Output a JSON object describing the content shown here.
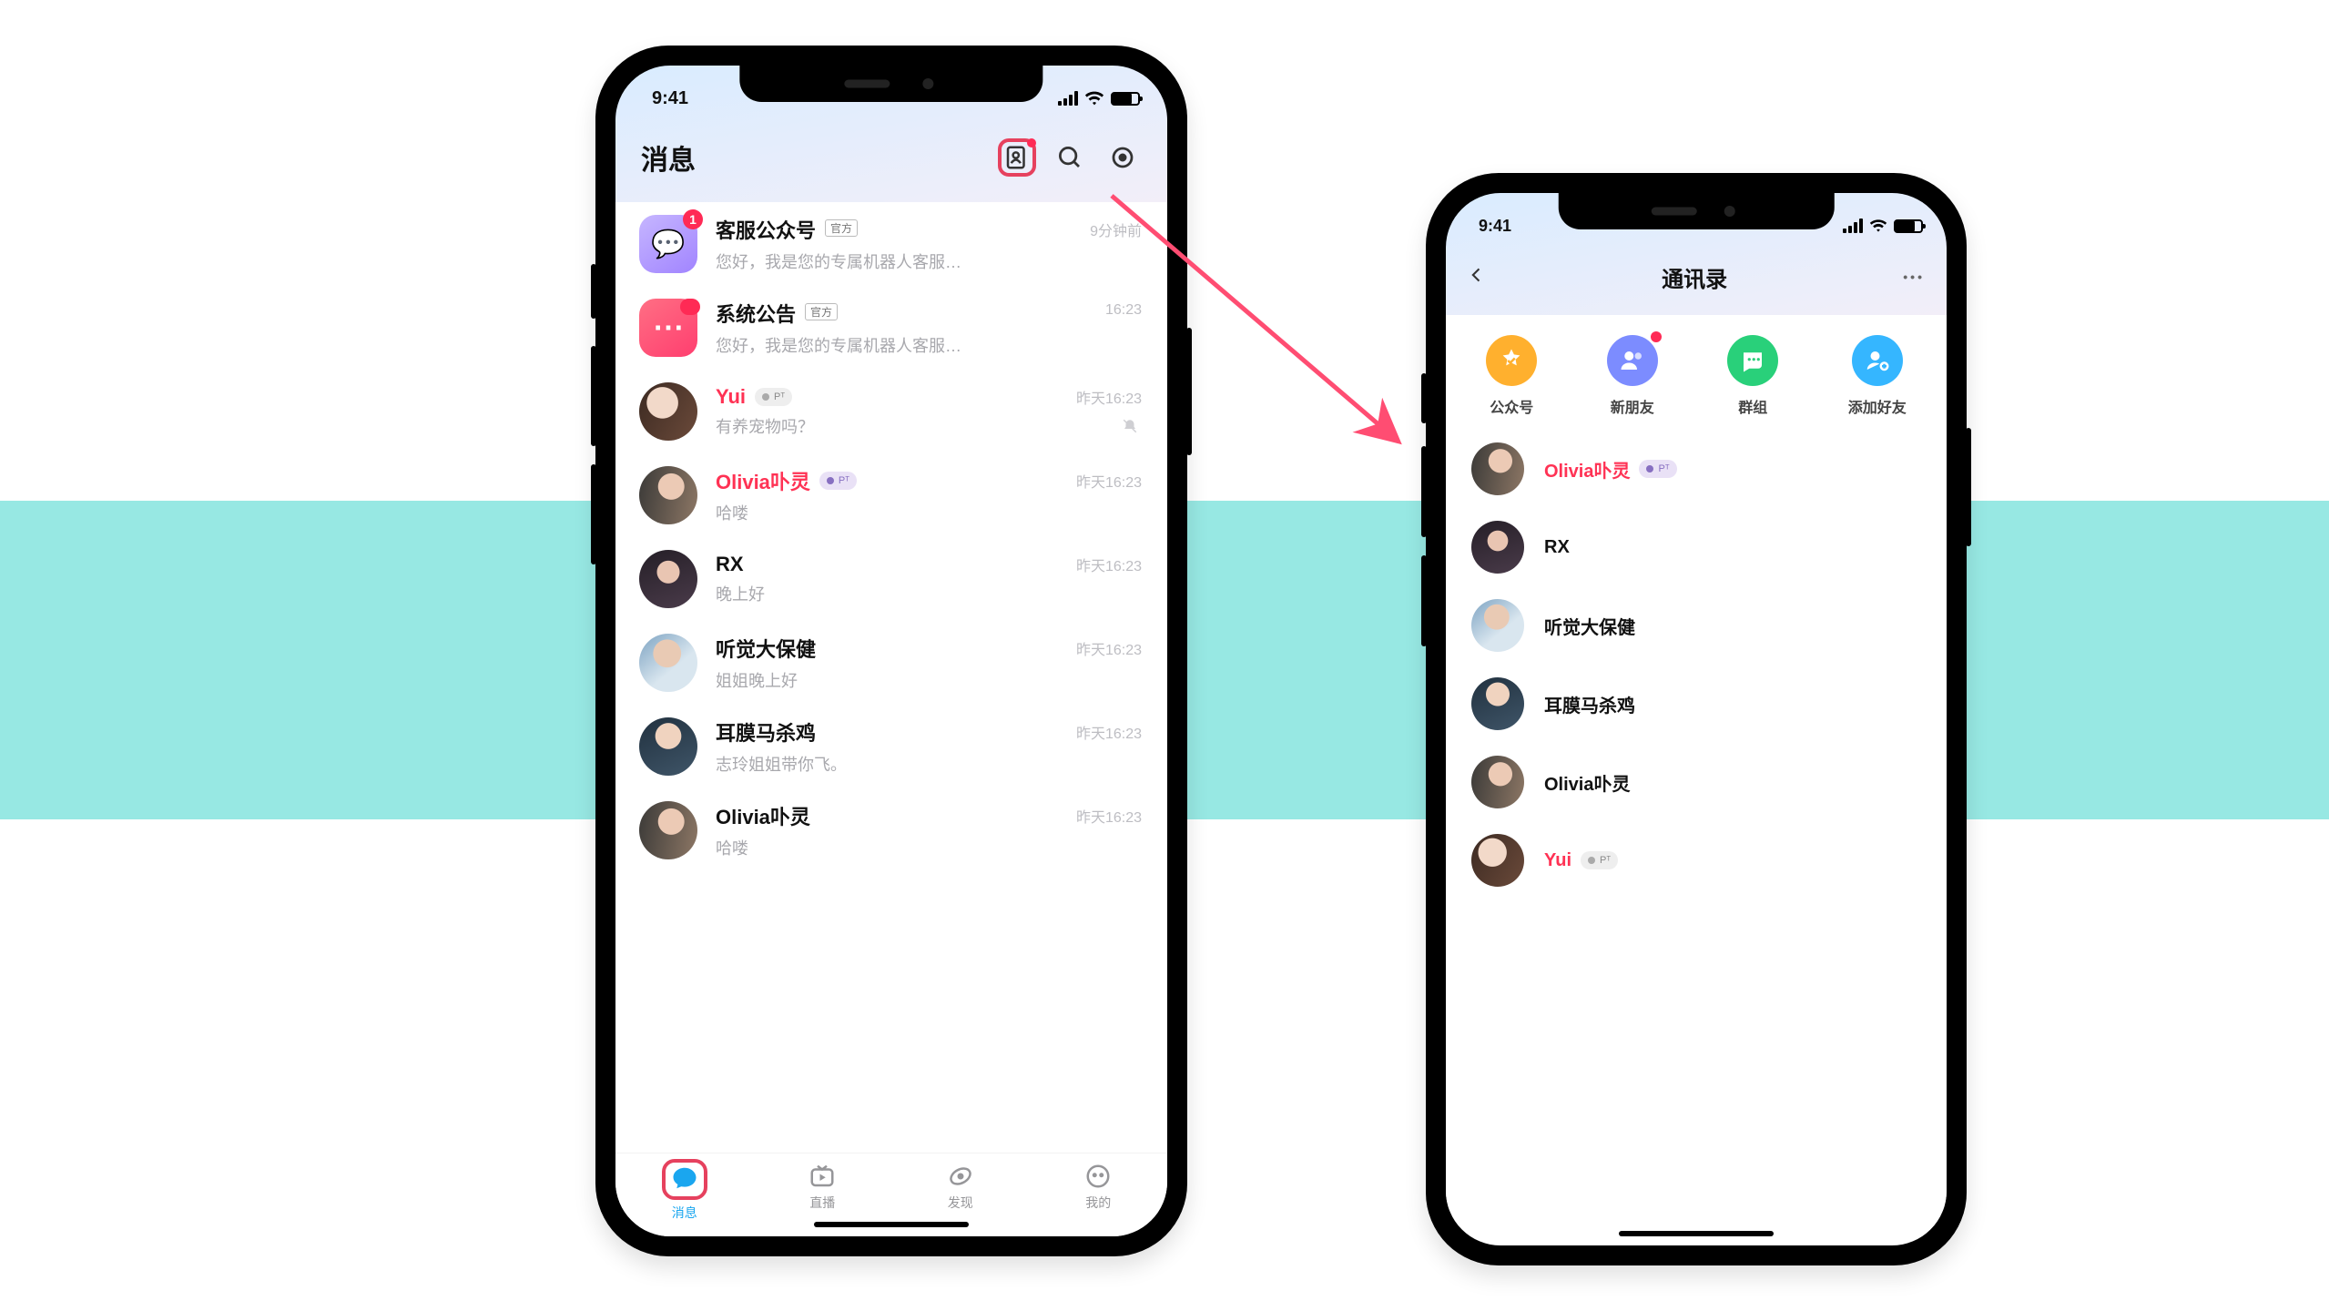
{
  "status_time": "9:41",
  "phone1": {
    "title": "消息",
    "header_icons": [
      "contacts-icon",
      "search-icon",
      "target-icon"
    ],
    "chats": [
      {
        "avatar": "s1",
        "name": "客服公众号",
        "name_color": "",
        "official": "官方",
        "badge_type": "num",
        "badge": "1",
        "preview": "您好，我是您的专属机器人客服…",
        "time": "9分钟前",
        "muted": false
      },
      {
        "avatar": "s2",
        "name": "系统公告",
        "name_color": "",
        "official": "官方",
        "badge_type": "bar",
        "badge": "",
        "preview": "您好，我是您的专属机器人客服…",
        "time": "16:23",
        "muted": false
      },
      {
        "avatar": "a1",
        "name": "Yui",
        "name_color": "red",
        "pill": "gray",
        "preview": "有养宠物吗？",
        "time": "昨天16:23",
        "muted": true
      },
      {
        "avatar": "a2",
        "name": "Olivia卟灵",
        "name_color": "red",
        "pill": "purple",
        "preview": "哈喽",
        "time": "昨天16:23",
        "muted": false
      },
      {
        "avatar": "a3",
        "name": "RX",
        "name_color": "",
        "preview": "晚上好",
        "time": "昨天16:23",
        "muted": false
      },
      {
        "avatar": "a4",
        "name": "听觉大保健",
        "name_color": "",
        "preview": "姐姐晚上好",
        "time": "昨天16:23",
        "muted": false
      },
      {
        "avatar": "a5",
        "name": "耳膜马杀鸡",
        "name_color": "",
        "preview": "志玲姐姐带你飞。",
        "time": "昨天16:23",
        "muted": false
      },
      {
        "avatar": "a2",
        "name": "Olivia卟灵",
        "name_color": "",
        "preview": "哈喽",
        "time": "昨天16:23",
        "muted": false
      }
    ],
    "bottom_nav": [
      {
        "label": "消息",
        "active": true
      },
      {
        "label": "直播",
        "active": false
      },
      {
        "label": "发现",
        "active": false
      },
      {
        "label": "我的",
        "active": false
      }
    ]
  },
  "phone2": {
    "title": "通讯录",
    "more": "•••",
    "quick": [
      {
        "label": "公众号",
        "color": "#ffb02e",
        "icon": "check"
      },
      {
        "label": "新朋友",
        "color": "#7c8cff",
        "icon": "friends",
        "dot": true
      },
      {
        "label": "群组",
        "color": "#29d07a",
        "icon": "group"
      },
      {
        "label": "添加好友",
        "color": "#35b6ff",
        "icon": "add"
      }
    ],
    "contacts": [
      {
        "avatar": "a2",
        "name": "Olivia卟灵",
        "name_color": "red",
        "pill": "purple"
      },
      {
        "avatar": "a3",
        "name": "RX"
      },
      {
        "avatar": "a4",
        "name": "听觉大保健"
      },
      {
        "avatar": "a5",
        "name": "耳膜马杀鸡"
      },
      {
        "avatar": "a2",
        "name": "Olivia卟灵"
      },
      {
        "avatar": "a1",
        "name": "Yui",
        "name_color": "red",
        "pill": "gray"
      }
    ]
  }
}
